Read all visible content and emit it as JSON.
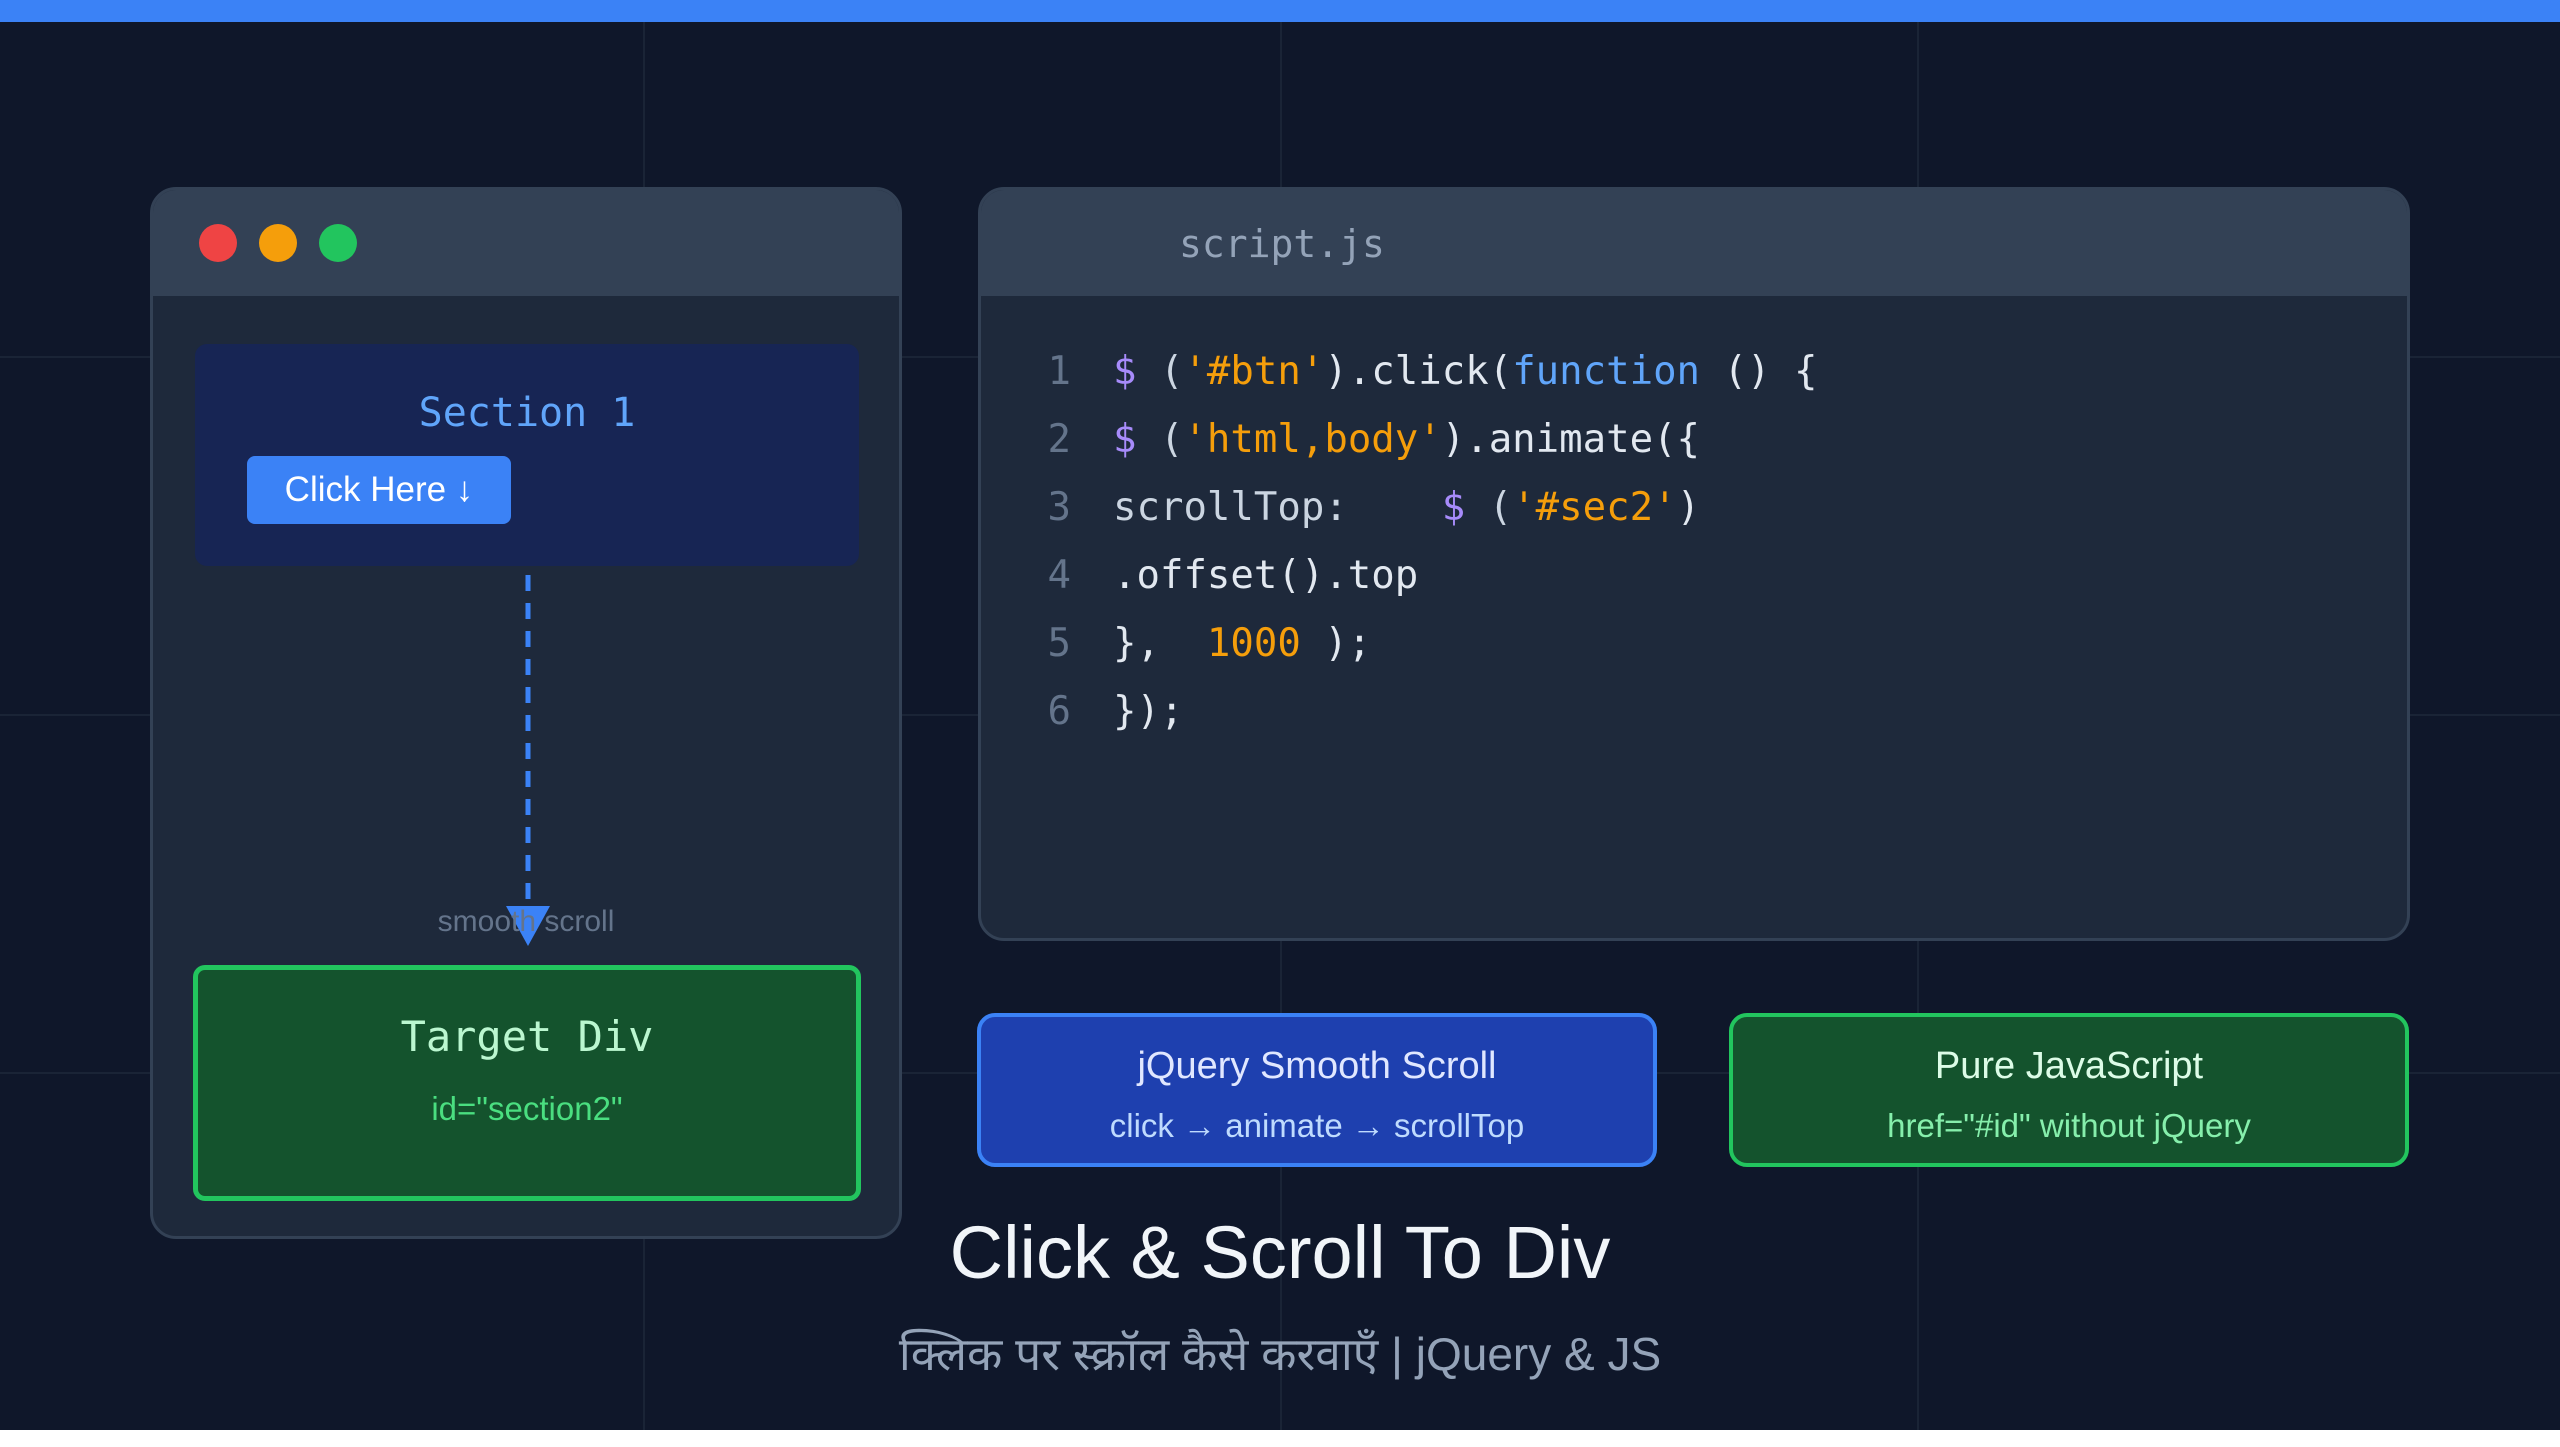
{
  "colors": {
    "accent_bar": "#3b82f6",
    "background": "#0f172a",
    "close_dot": "#ef4444",
    "minimize_dot": "#f59e0b",
    "maximize_dot": "#22c55e",
    "jquery_accent": "#3b82f6",
    "javascript_accent": "#22c55e"
  },
  "browser": {
    "section1_title": "Section 1",
    "button_label": "Click Here ↓",
    "scroll_label": "smooth scroll",
    "target_title": "Target Div",
    "target_id": "id=\"section2\""
  },
  "editor": {
    "filename": "script.js",
    "lines": [
      {
        "num": "1"
      },
      {
        "num": "2"
      },
      {
        "num": "3"
      },
      {
        "num": "4"
      },
      {
        "num": "5"
      },
      {
        "num": "6"
      }
    ],
    "tokens": {
      "l1_dollar": "$",
      "l1_open": " (",
      "l1_str": "'#btn'",
      "l1_mid": ").click(",
      "l1_kw": "function",
      "l1_end": " () {",
      "l2_dollar": "$",
      "l2_open": " (",
      "l2_str": "'html,body'",
      "l2_end": ").animate({",
      "l3_prop": "scrollTop:    ",
      "l3_dollar": "$",
      "l3_open": " (",
      "l3_str": "'#sec2'",
      "l3_end": ")",
      "l4_text": ".offset().top",
      "l5_open": "},  ",
      "l5_num": "1000",
      "l5_end": " );",
      "l6_text": "});"
    }
  },
  "cards": {
    "jquery_title": "jQuery Smooth Scroll",
    "jquery_subtitle": "click → animate → scrollTop",
    "js_title": "Pure JavaScript",
    "js_subtitle": "href=\"#id\" without jQuery"
  },
  "title": "Click & Scroll To Div",
  "subtitle": "क्लिक पर स्क्रॉल कैसे करवाएँ | jQuery & JS"
}
